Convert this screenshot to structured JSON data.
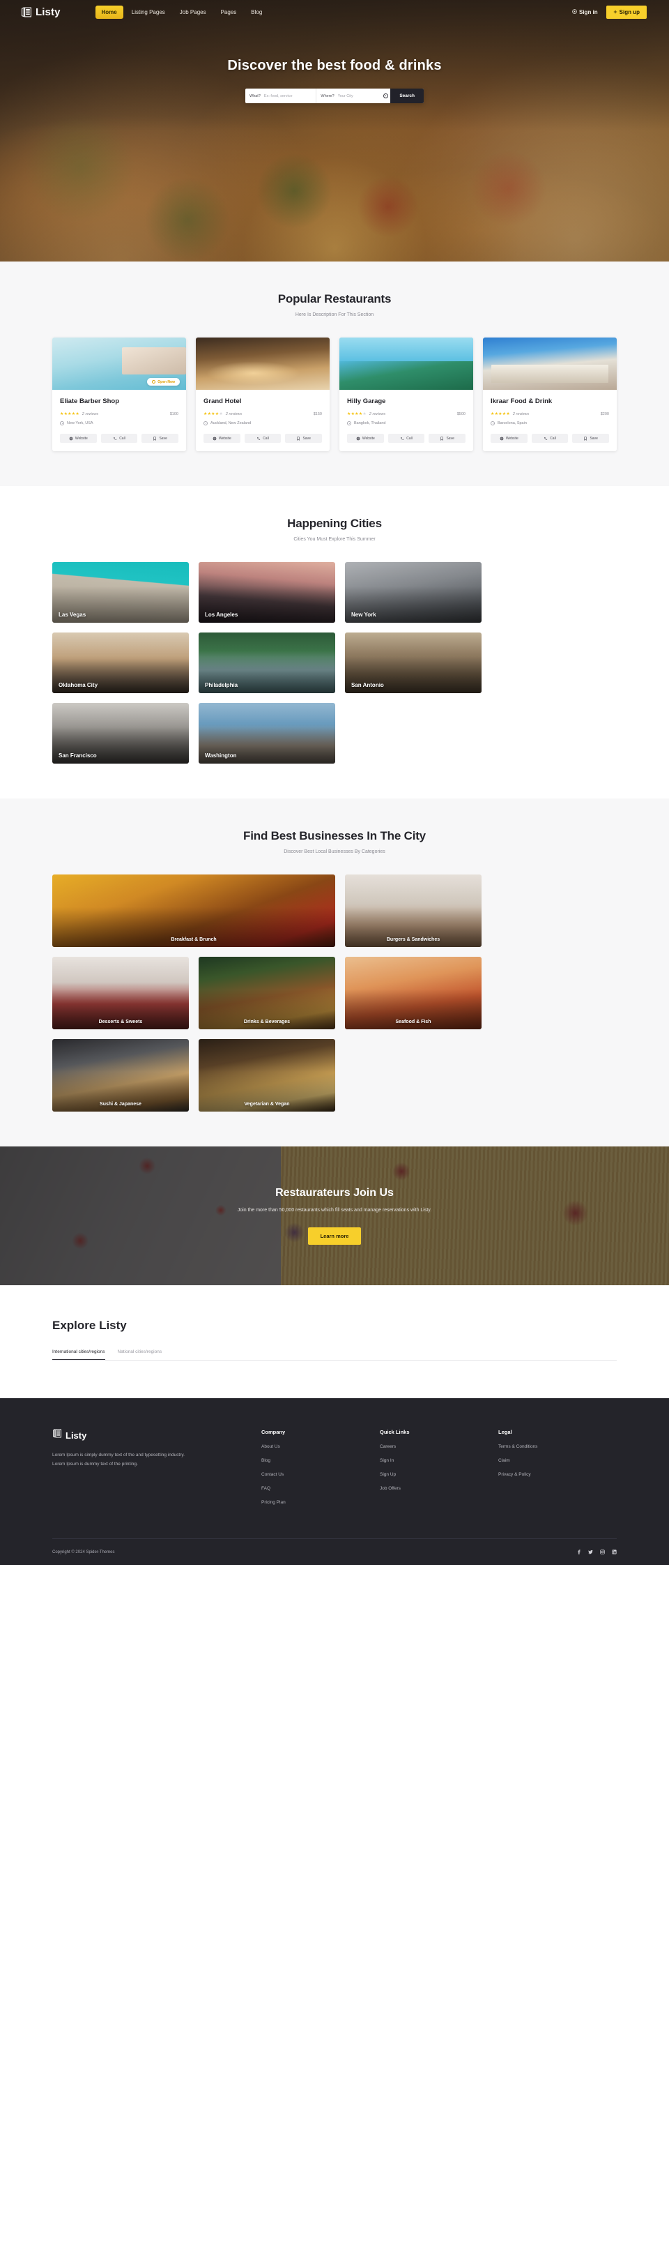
{
  "brand": {
    "name": "Listy",
    "icon": "listing-book-icon"
  },
  "nav": {
    "links": [
      {
        "label": "Home",
        "active": true
      },
      {
        "label": "Listing Pages",
        "active": false
      },
      {
        "label": "Job Pages",
        "active": false
      },
      {
        "label": "Pages",
        "active": false
      },
      {
        "label": "Blog",
        "active": false
      }
    ],
    "sign_in": "Sign in",
    "sign_up": "Sign up"
  },
  "hero": {
    "title": "Discover the best food & drinks",
    "what_label": "What?",
    "what_placeholder": "Ex: food, service",
    "where_label": "Where?",
    "where_placeholder": "Your City",
    "search_button": "Search",
    "geo_icon": "locate-icon"
  },
  "restaurants": {
    "title": "Popular Restaurants",
    "subtitle": "Here Is Description For This Section",
    "open_badge": "Open Now",
    "actions": {
      "website": "Website",
      "call": "Call",
      "save": "Save"
    },
    "items": [
      {
        "name": "Eliate Barber Shop",
        "stars": 5,
        "reviews": "2 reviews",
        "price": "$100",
        "location": "New York, USA",
        "open": true
      },
      {
        "name": "Grand Hotel",
        "stars": 4.5,
        "reviews": "2 reviews",
        "price": "$150",
        "location": "Auckland, New Zealand",
        "open": false
      },
      {
        "name": "Hilly Garage",
        "stars": 4,
        "reviews": "2 reviews",
        "price": "$500",
        "location": "Bangkok, Thailand",
        "open": false
      },
      {
        "name": "Ikraar Food & Drink",
        "stars": 5,
        "reviews": "2 reviews",
        "price": "$200",
        "location": "Barcelona, Spain",
        "open": false
      }
    ]
  },
  "cities": {
    "title": "Happening Cities",
    "subtitle": "Cities You Must Explore This Summer",
    "items": [
      {
        "name": "Las Vegas"
      },
      {
        "name": "Los Angeles"
      },
      {
        "name": "New York"
      },
      {
        "name": "Oklahoma City"
      },
      {
        "name": "Philadelphia"
      },
      {
        "name": "San Antonio"
      },
      {
        "name": "San Francisco"
      },
      {
        "name": "Washington"
      }
    ]
  },
  "categories": {
    "title": "Find Best Businesses In The City",
    "subtitle": "Discover Best Local Businesses By Categories",
    "items": [
      {
        "name": "Breakfast & Brunch"
      },
      {
        "name": "Burgers & Sandwiches"
      },
      {
        "name": "Desserts & Sweets"
      },
      {
        "name": "Drinks & Beverages"
      },
      {
        "name": "Seafood & Fish"
      },
      {
        "name": "Sushi & Japanese"
      },
      {
        "name": "Vegetarian & Vegan"
      }
    ]
  },
  "cta": {
    "title": "Restaurateurs Join Us",
    "text": "Join the more than 50,000 restaurants which fill seats and manage reservations with Listy.",
    "button": "Learn more"
  },
  "explore": {
    "title": "Explore Listy",
    "tabs": [
      {
        "label": "International cities/regions",
        "active": true
      },
      {
        "label": "National cities/regions",
        "active": false
      }
    ]
  },
  "footer": {
    "brand": "Listy",
    "description": "Lorem Ipsum is simply dummy text of the and typesetting industry. Lorem Ipsum is dummy text of the printing.",
    "columns": [
      {
        "heading": "Company",
        "links": [
          "About Us",
          "Blog",
          "Contact Us",
          "FAQ",
          "Pricing Plan"
        ]
      },
      {
        "heading": "Quick Links",
        "links": [
          "Careers",
          "Sign In",
          "Sign Up",
          "Job Offers"
        ]
      },
      {
        "heading": "Legal",
        "links": [
          "Terms & Conditions",
          "Claim",
          "Privacy & Policy"
        ]
      }
    ],
    "copyright": "Copyright © 2024 Spider-Themes",
    "socials": [
      "facebook-icon",
      "twitter-icon",
      "instagram-icon",
      "linkedin-icon"
    ]
  },
  "colors": {
    "accent": "#f7cf2b",
    "dark": "#24242a",
    "star": "#f5c211"
  }
}
